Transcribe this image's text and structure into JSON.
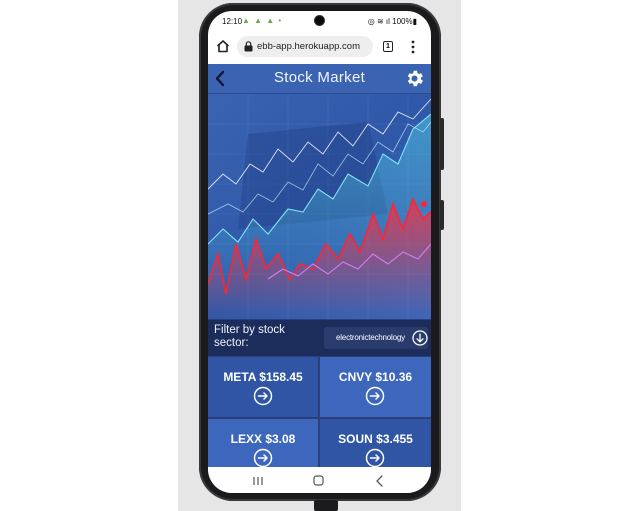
{
  "status_bar": {
    "time": "12:10",
    "notification_glyphs": "▲ ▲ ▲ •",
    "right_icons": "◎ ≋ ıl 100%▮"
  },
  "browser": {
    "url": "ebb-app.herokuapp.com",
    "tab_count": "1"
  },
  "app": {
    "title": "Stock Market",
    "filter_label": "Filter by stock sector:",
    "selected_sector": "electronictechnology"
  },
  "stocks": [
    {
      "label": "META $158.45"
    },
    {
      "label": "CNVY $10.36"
    },
    {
      "label": "LEXX $3.08"
    },
    {
      "label": "SOUN $3.455"
    }
  ],
  "colors": {
    "header_blue": "#3a63b2",
    "card_blue_dark": "#2f55a4",
    "card_blue_light": "#3d67bd",
    "filter_bar": "#1c2d5c"
  },
  "icons": {
    "back": "chevron-left-icon",
    "settings": "gear-icon",
    "sector_dropdown": "arrow-down-circle-icon",
    "stock_link": "arrow-right-circle-icon"
  }
}
